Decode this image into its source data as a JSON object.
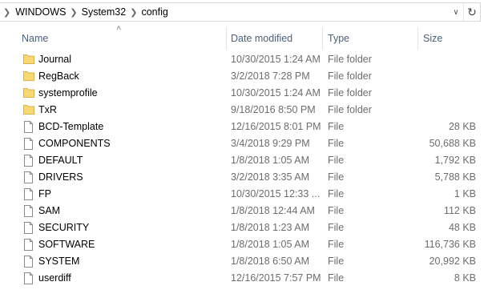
{
  "address": {
    "crumbs": [
      "WINDOWS",
      "System32",
      "config"
    ],
    "refresh_icon": "refresh-icon",
    "dropdown_icon": "chevron-down-icon"
  },
  "columns": {
    "name": "Name",
    "date": "Date modified",
    "type": "Type",
    "size": "Size"
  },
  "colors": {
    "folder": "#f8d775",
    "header_text": "#4c607a",
    "muted_text": "#6d6d6d"
  },
  "files": [
    {
      "name": "Journal",
      "date": "10/30/2015 1:24 AM",
      "type": "File folder",
      "size": "",
      "icon": "folder-icon"
    },
    {
      "name": "RegBack",
      "date": "3/2/2018 7:28 PM",
      "type": "File folder",
      "size": "",
      "icon": "folder-icon"
    },
    {
      "name": "systemprofile",
      "date": "10/30/2015 1:24 AM",
      "type": "File folder",
      "size": "",
      "icon": "folder-icon"
    },
    {
      "name": "TxR",
      "date": "9/18/2016 8:50 PM",
      "type": "File folder",
      "size": "",
      "icon": "folder-icon"
    },
    {
      "name": "BCD-Template",
      "date": "12/16/2015 8:01 PM",
      "type": "File",
      "size": "28 KB",
      "icon": "file-icon"
    },
    {
      "name": "COMPONENTS",
      "date": "3/4/2018 9:29 PM",
      "type": "File",
      "size": "50,688 KB",
      "icon": "file-icon"
    },
    {
      "name": "DEFAULT",
      "date": "1/8/2018 1:05 AM",
      "type": "File",
      "size": "1,792 KB",
      "icon": "file-icon"
    },
    {
      "name": "DRIVERS",
      "date": "3/2/2018 3:35 AM",
      "type": "File",
      "size": "5,788 KB",
      "icon": "file-icon"
    },
    {
      "name": "FP",
      "date": "10/30/2015 12:33 ...",
      "type": "File",
      "size": "1 KB",
      "icon": "file-icon"
    },
    {
      "name": "SAM",
      "date": "1/8/2018 12:44 AM",
      "type": "File",
      "size": "112 KB",
      "icon": "file-icon"
    },
    {
      "name": "SECURITY",
      "date": "1/8/2018 1:23 AM",
      "type": "File",
      "size": "48 KB",
      "icon": "file-icon"
    },
    {
      "name": "SOFTWARE",
      "date": "1/8/2018 1:05 AM",
      "type": "File",
      "size": "116,736 KB",
      "icon": "file-icon"
    },
    {
      "name": "SYSTEM",
      "date": "1/8/2018 6:50 AM",
      "type": "File",
      "size": "20,992 KB",
      "icon": "file-icon"
    },
    {
      "name": "userdiff",
      "date": "12/16/2015 7:57 PM",
      "type": "File",
      "size": "8 KB",
      "icon": "file-icon"
    }
  ]
}
